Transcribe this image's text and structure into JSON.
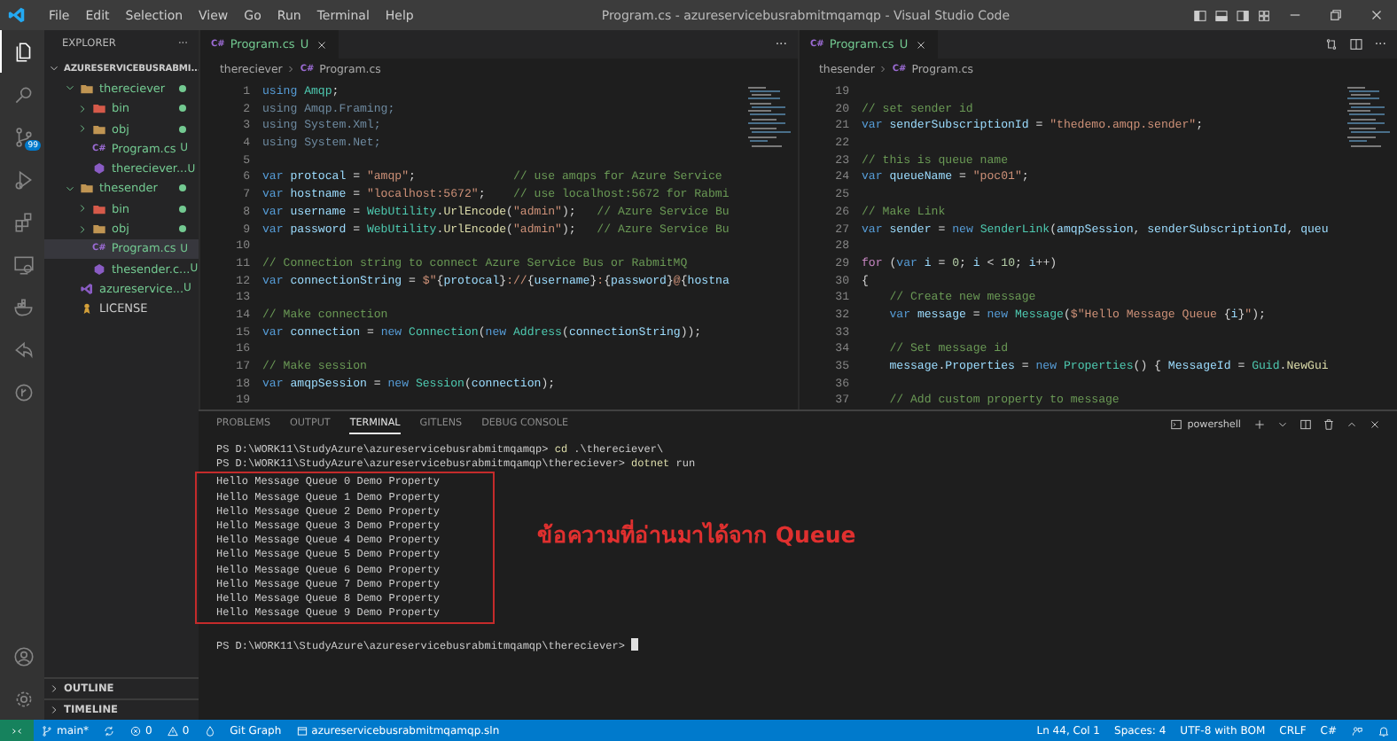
{
  "title_bar": {
    "menu": [
      "File",
      "Edit",
      "Selection",
      "View",
      "Go",
      "Run",
      "Terminal",
      "Help"
    ],
    "title": "Program.cs - azureservicebusrabmitmqamqp - Visual Studio Code",
    "layout_controls": [
      {
        "kind": "sidebar"
      },
      {
        "kind": "panel"
      },
      {
        "kind": "secondary"
      },
      {
        "kind": "customize"
      }
    ]
  },
  "activity_bar": {
    "items": [
      {
        "kind": "files",
        "selected": true
      },
      {
        "kind": "search",
        "selected": false
      },
      {
        "kind": "source-control",
        "selected": false,
        "badge": "99"
      },
      {
        "kind": "run",
        "selected": false
      },
      {
        "kind": "extensions",
        "selected": false
      },
      {
        "kind": "remote",
        "selected": false
      },
      {
        "kind": "docker",
        "selected": false
      },
      {
        "kind": "liveshare",
        "selected": false
      },
      {
        "kind": "gitlens",
        "selected": false
      }
    ],
    "bottom": [
      {
        "kind": "account",
        "selected": false
      },
      {
        "kind": "gear",
        "selected": false
      }
    ]
  },
  "explorer": {
    "title": "EXPLORER",
    "more": "···",
    "root": {
      "label": "AZURESERVICEBUSRABMI...",
      "expanded": true,
      "children": [
        {
          "label": "thereciever",
          "kind": "folder",
          "expanded": true,
          "untracked": true,
          "selected": false,
          "children": [
            {
              "label": "bin",
              "kind": "bin-folder",
              "expanded": false,
              "untracked": true,
              "selected": false
            },
            {
              "label": "obj",
              "kind": "folder",
              "expanded": false,
              "untracked": true,
              "selected": false
            },
            {
              "label": "Program.cs",
              "kind": "csharp",
              "glyph": "C#",
              "status": "U",
              "untracked": true,
              "selected": false
            },
            {
              "label": "thereciever...",
              "kind": "project",
              "status": "U",
              "untracked": true,
              "selected": false
            }
          ]
        },
        {
          "label": "thesender",
          "kind": "folder",
          "expanded": true,
          "untracked": true,
          "selected": false,
          "children": [
            {
              "label": "bin",
              "kind": "bin-folder",
              "expanded": false,
              "untracked": true,
              "selected": false
            },
            {
              "label": "obj",
              "kind": "folder",
              "expanded": false,
              "untracked": true,
              "selected": false
            },
            {
              "label": "Program.cs",
              "kind": "csharp",
              "glyph": "C#",
              "status": "U",
              "untracked": true,
              "selected": true
            },
            {
              "label": "thesender.c...",
              "kind": "project",
              "status": "U",
              "untracked": true,
              "selected": false
            }
          ]
        },
        {
          "label": "azureservice...",
          "kind": "solution",
          "status": "U",
          "untracked": true,
          "selected": false
        },
        {
          "label": "LICENSE",
          "kind": "license",
          "untracked": false,
          "selected": false
        }
      ]
    },
    "sections": [
      {
        "label": "OUTLINE",
        "expanded": false
      },
      {
        "label": "TIMELINE",
        "expanded": false
      }
    ]
  },
  "editors": [
    {
      "tab": {
        "glyph": "C#",
        "label": "Program.cs",
        "status": "U",
        "selected": true
      },
      "actions": [
        {
          "kind": "more",
          "text": "···"
        }
      ],
      "breadcrumb": {
        "folder": "thereciever",
        "glyph": "C#",
        "file": "Program.cs"
      },
      "lines": [
        {
          "number": "1",
          "tokens": [
            {
              "kind": "keyword",
              "text": "using "
            },
            {
              "kind": "type",
              "text": "Amqp"
            },
            {
              "kind": "plain",
              "text": ";"
            }
          ]
        },
        {
          "number": "2",
          "tokens": [
            {
              "kind": "faded",
              "text": "using Amqp.Framing;"
            }
          ]
        },
        {
          "number": "3",
          "tokens": [
            {
              "kind": "faded",
              "text": "using System.Xml;"
            }
          ]
        },
        {
          "number": "4",
          "tokens": [
            {
              "kind": "faded",
              "text": "using System.Net;"
            }
          ]
        },
        {
          "number": "5"
        },
        {
          "number": "6",
          "tokens": [
            {
              "kind": "keyword",
              "text": "var "
            },
            {
              "kind": "variable",
              "text": "protocal"
            },
            {
              "kind": "plain",
              "text": " = "
            },
            {
              "kind": "string",
              "text": "\"amqp\""
            },
            {
              "kind": "plain",
              "text": ";              "
            },
            {
              "kind": "comment",
              "text": "// use amqps for Azure Service"
            }
          ]
        },
        {
          "number": "7",
          "tokens": [
            {
              "kind": "keyword",
              "text": "var "
            },
            {
              "kind": "variable",
              "text": "hostname"
            },
            {
              "kind": "plain",
              "text": " = "
            },
            {
              "kind": "string",
              "text": "\"localhost:5672\""
            },
            {
              "kind": "plain",
              "text": ";    "
            },
            {
              "kind": "comment",
              "text": "// use localhost:5672 for Rabmi"
            }
          ]
        },
        {
          "number": "8",
          "tokens": [
            {
              "kind": "keyword",
              "text": "var "
            },
            {
              "kind": "variable",
              "text": "username"
            },
            {
              "kind": "plain",
              "text": " = "
            },
            {
              "kind": "type",
              "text": "WebUtility"
            },
            {
              "kind": "plain",
              "text": "."
            },
            {
              "kind": "function",
              "text": "UrlEncode"
            },
            {
              "kind": "plain",
              "text": "("
            },
            {
              "kind": "string",
              "text": "\"admin\""
            },
            {
              "kind": "plain",
              "text": ");   "
            },
            {
              "kind": "comment",
              "text": "// Azure Service Bu"
            }
          ]
        },
        {
          "number": "9",
          "tokens": [
            {
              "kind": "keyword",
              "text": "var "
            },
            {
              "kind": "variable",
              "text": "password"
            },
            {
              "kind": "plain",
              "text": " = "
            },
            {
              "kind": "type",
              "text": "WebUtility"
            },
            {
              "kind": "plain",
              "text": "."
            },
            {
              "kind": "function",
              "text": "UrlEncode"
            },
            {
              "kind": "plain",
              "text": "("
            },
            {
              "kind": "string",
              "text": "\"admin\""
            },
            {
              "kind": "plain",
              "text": ");   "
            },
            {
              "kind": "comment",
              "text": "// Azure Service Bu"
            }
          ]
        },
        {
          "number": "10"
        },
        {
          "number": "11",
          "tokens": [
            {
              "kind": "comment",
              "text": "// Connection string to connect Azure Service Bus or RabmitMQ"
            }
          ]
        },
        {
          "number": "12",
          "tokens": [
            {
              "kind": "keyword",
              "text": "var "
            },
            {
              "kind": "variable",
              "text": "connectionString"
            },
            {
              "kind": "plain",
              "text": " = "
            },
            {
              "kind": "string",
              "text": "$\""
            },
            {
              "kind": "plain",
              "text": "{"
            },
            {
              "kind": "variable",
              "text": "protocal"
            },
            {
              "kind": "plain",
              "text": "}"
            },
            {
              "kind": "string",
              "text": "://"
            },
            {
              "kind": "plain",
              "text": "{"
            },
            {
              "kind": "variable",
              "text": "username"
            },
            {
              "kind": "plain",
              "text": "}"
            },
            {
              "kind": "string",
              "text": ":"
            },
            {
              "kind": "plain",
              "text": "{"
            },
            {
              "kind": "variable",
              "text": "password"
            },
            {
              "kind": "plain",
              "text": "}"
            },
            {
              "kind": "string",
              "text": "@"
            },
            {
              "kind": "plain",
              "text": "{"
            },
            {
              "kind": "variable",
              "text": "hostna"
            }
          ]
        },
        {
          "number": "13"
        },
        {
          "number": "14",
          "tokens": [
            {
              "kind": "comment",
              "text": "// Make connection"
            }
          ]
        },
        {
          "number": "15",
          "tokens": [
            {
              "kind": "keyword",
              "text": "var "
            },
            {
              "kind": "variable",
              "text": "connection"
            },
            {
              "kind": "plain",
              "text": " = "
            },
            {
              "kind": "keyword",
              "text": "new "
            },
            {
              "kind": "type",
              "text": "Connection"
            },
            {
              "kind": "plain",
              "text": "("
            },
            {
              "kind": "keyword",
              "text": "new "
            },
            {
              "kind": "type",
              "text": "Address"
            },
            {
              "kind": "plain",
              "text": "("
            },
            {
              "kind": "variable",
              "text": "connectionString"
            },
            {
              "kind": "plain",
              "text": "));"
            }
          ]
        },
        {
          "number": "16"
        },
        {
          "number": "17",
          "tokens": [
            {
              "kind": "comment",
              "text": "// Make session"
            }
          ]
        },
        {
          "number": "18",
          "tokens": [
            {
              "kind": "keyword",
              "text": "var "
            },
            {
              "kind": "variable",
              "text": "amqpSession"
            },
            {
              "kind": "plain",
              "text": " = "
            },
            {
              "kind": "keyword",
              "text": "new "
            },
            {
              "kind": "type",
              "text": "Session"
            },
            {
              "kind": "plain",
              "text": "("
            },
            {
              "kind": "variable",
              "text": "connection"
            },
            {
              "kind": "plain",
              "text": ");"
            }
          ]
        },
        {
          "number": "19"
        }
      ]
    },
    {
      "tab": {
        "glyph": "C#",
        "label": "Program.cs",
        "status": "U",
        "selected": true
      },
      "actions": [
        {
          "kind": "compare"
        },
        {
          "kind": "split"
        },
        {
          "kind": "more",
          "text": "···"
        }
      ],
      "breadcrumb": {
        "folder": "thesender",
        "glyph": "C#",
        "file": "Program.cs"
      },
      "lines": [
        {
          "number": "19"
        },
        {
          "number": "20",
          "tokens": [
            {
              "kind": "comment",
              "text": "// set sender id"
            }
          ]
        },
        {
          "number": "21",
          "tokens": [
            {
              "kind": "keyword",
              "text": "var "
            },
            {
              "kind": "variable",
              "text": "senderSubscriptionId"
            },
            {
              "kind": "plain",
              "text": " = "
            },
            {
              "kind": "string",
              "text": "\"thedemo.amqp.sender\""
            },
            {
              "kind": "plain",
              "text": ";"
            }
          ]
        },
        {
          "number": "22"
        },
        {
          "number": "23",
          "tokens": [
            {
              "kind": "comment",
              "text": "// this is queue name"
            }
          ]
        },
        {
          "number": "24",
          "tokens": [
            {
              "kind": "keyword",
              "text": "var "
            },
            {
              "kind": "variable",
              "text": "queueName"
            },
            {
              "kind": "plain",
              "text": " = "
            },
            {
              "kind": "string",
              "text": "\"poc01\""
            },
            {
              "kind": "plain",
              "text": ";"
            }
          ]
        },
        {
          "number": "25"
        },
        {
          "number": "26",
          "tokens": [
            {
              "kind": "comment",
              "text": "// Make Link"
            }
          ]
        },
        {
          "number": "27",
          "tokens": [
            {
              "kind": "keyword",
              "text": "var "
            },
            {
              "kind": "variable",
              "text": "sender"
            },
            {
              "kind": "plain",
              "text": " = "
            },
            {
              "kind": "keyword",
              "text": "new "
            },
            {
              "kind": "type",
              "text": "SenderLink"
            },
            {
              "kind": "plain",
              "text": "("
            },
            {
              "kind": "variable",
              "text": "amqpSession"
            },
            {
              "kind": "plain",
              "text": ", "
            },
            {
              "kind": "variable",
              "text": "senderSubscriptionId"
            },
            {
              "kind": "plain",
              "text": ", "
            },
            {
              "kind": "variable",
              "text": "queu"
            }
          ]
        },
        {
          "number": "28"
        },
        {
          "number": "29",
          "tokens": [
            {
              "kind": "control",
              "text": "for"
            },
            {
              "kind": "plain",
              "text": " ("
            },
            {
              "kind": "keyword",
              "text": "var "
            },
            {
              "kind": "variable",
              "text": "i"
            },
            {
              "kind": "plain",
              "text": " = "
            },
            {
              "kind": "number",
              "text": "0"
            },
            {
              "kind": "plain",
              "text": "; "
            },
            {
              "kind": "variable",
              "text": "i"
            },
            {
              "kind": "plain",
              "text": " < "
            },
            {
              "kind": "number",
              "text": "10"
            },
            {
              "kind": "plain",
              "text": "; "
            },
            {
              "kind": "variable",
              "text": "i"
            },
            {
              "kind": "plain",
              "text": "++)"
            }
          ]
        },
        {
          "number": "30",
          "tokens": [
            {
              "kind": "plain",
              "text": "{"
            }
          ]
        },
        {
          "number": "31",
          "tokens": [
            {
              "kind": "comment",
              "text": "    // Create new message"
            }
          ]
        },
        {
          "number": "32",
          "tokens": [
            {
              "kind": "keyword",
              "text": "    var "
            },
            {
              "kind": "variable",
              "text": "message"
            },
            {
              "kind": "plain",
              "text": " = "
            },
            {
              "kind": "keyword",
              "text": "new "
            },
            {
              "kind": "type",
              "text": "Message"
            },
            {
              "kind": "plain",
              "text": "("
            },
            {
              "kind": "string",
              "text": "$\"Hello Message Queue "
            },
            {
              "kind": "plain",
              "text": "{"
            },
            {
              "kind": "variable",
              "text": "i"
            },
            {
              "kind": "plain",
              "text": "}"
            },
            {
              "kind": "string",
              "text": "\""
            },
            {
              "kind": "plain",
              "text": ");"
            }
          ]
        },
        {
          "number": "33"
        },
        {
          "number": "34",
          "tokens": [
            {
              "kind": "comment",
              "text": "    // Set message id"
            }
          ]
        },
        {
          "number": "35",
          "tokens": [
            {
              "kind": "variable",
              "text": "    message"
            },
            {
              "kind": "plain",
              "text": "."
            },
            {
              "kind": "variable",
              "text": "Properties"
            },
            {
              "kind": "plain",
              "text": " = "
            },
            {
              "kind": "keyword",
              "text": "new "
            },
            {
              "kind": "type",
              "text": "Properties"
            },
            {
              "kind": "plain",
              "text": "() { "
            },
            {
              "kind": "variable",
              "text": "MessageId"
            },
            {
              "kind": "plain",
              "text": " = "
            },
            {
              "kind": "type",
              "text": "Guid"
            },
            {
              "kind": "plain",
              "text": "."
            },
            {
              "kind": "function",
              "text": "NewGui"
            }
          ]
        },
        {
          "number": "36"
        },
        {
          "number": "37",
          "tokens": [
            {
              "kind": "comment",
              "text": "    // Add custom property to message"
            }
          ]
        }
      ]
    }
  ],
  "panel": {
    "tabs": [
      {
        "label": "PROBLEMS",
        "selected": false
      },
      {
        "label": "OUTPUT",
        "selected": false
      },
      {
        "label": "TERMINAL",
        "selected": true
      },
      {
        "label": "GITLENS",
        "selected": false
      },
      {
        "label": "DEBUG CONSOLE",
        "selected": false
      }
    ],
    "shell": "powershell",
    "actions": [
      {
        "kind": "plus"
      },
      {
        "kind": "chevron-down"
      },
      {
        "kind": "split"
      },
      {
        "kind": "trash"
      },
      {
        "kind": "chevron-up"
      },
      {
        "kind": "close"
      }
    ],
    "terminal": {
      "before": [
        {
          "prompt": "PS D:\\WORK11\\StudyAzure\\azureservicebusrabmitmqamqp> ",
          "command": "cd",
          "args": " .\\thereciever\\",
          "cursor": false
        },
        {
          "prompt": "PS D:\\WORK11\\StudyAzure\\azureservicebusrabmitmqamqp\\thereciever> ",
          "command": "dotnet",
          "args": " run",
          "cursor": false
        }
      ],
      "boxed": [
        "Hello Message Queue 0 Demo Property",
        "Hello Message Queue 1 Demo Property",
        "Hello Message Queue 2 Demo Property",
        "Hello Message Queue 3 Demo Property",
        "Hello Message Queue 4 Demo Property",
        "Hello Message Queue 5 Demo Property",
        "Hello Message Queue 6 Demo Property",
        "Hello Message Queue 7 Demo Property",
        "Hello Message Queue 8 Demo Property",
        "Hello Message Queue 9 Demo Property"
      ],
      "annotation": "ข้อความที่อ่านมาได้จาก Queue",
      "after": [
        {
          "prompt": "PS D:\\WORK11\\StudyAzure\\azureservicebusrabmitmqamqp\\thereciever> ",
          "cursor": true
        }
      ]
    }
  },
  "status_bar": {
    "left": [
      {
        "kind": "remote"
      },
      {
        "kind": "branch",
        "text": "main*"
      },
      {
        "kind": "sync"
      },
      {
        "kind": "errors",
        "text": "0"
      },
      {
        "kind": "warnings",
        "text": "0"
      },
      {
        "kind": "drop"
      },
      {
        "kind": "plain",
        "text": "Git Graph"
      },
      {
        "kind": "solution",
        "text": "azureservicebusrabmitmqamqp.sln"
      }
    ],
    "right": [
      {
        "kind": "plain",
        "text": "Ln 44, Col 1"
      },
      {
        "kind": "plain",
        "text": "Spaces: 4"
      },
      {
        "kind": "plain",
        "text": "UTF-8 with BOM"
      },
      {
        "kind": "plain",
        "text": "CRLF"
      },
      {
        "kind": "plain",
        "text": "C#"
      },
      {
        "kind": "feedback"
      },
      {
        "kind": "bell"
      }
    ]
  }
}
